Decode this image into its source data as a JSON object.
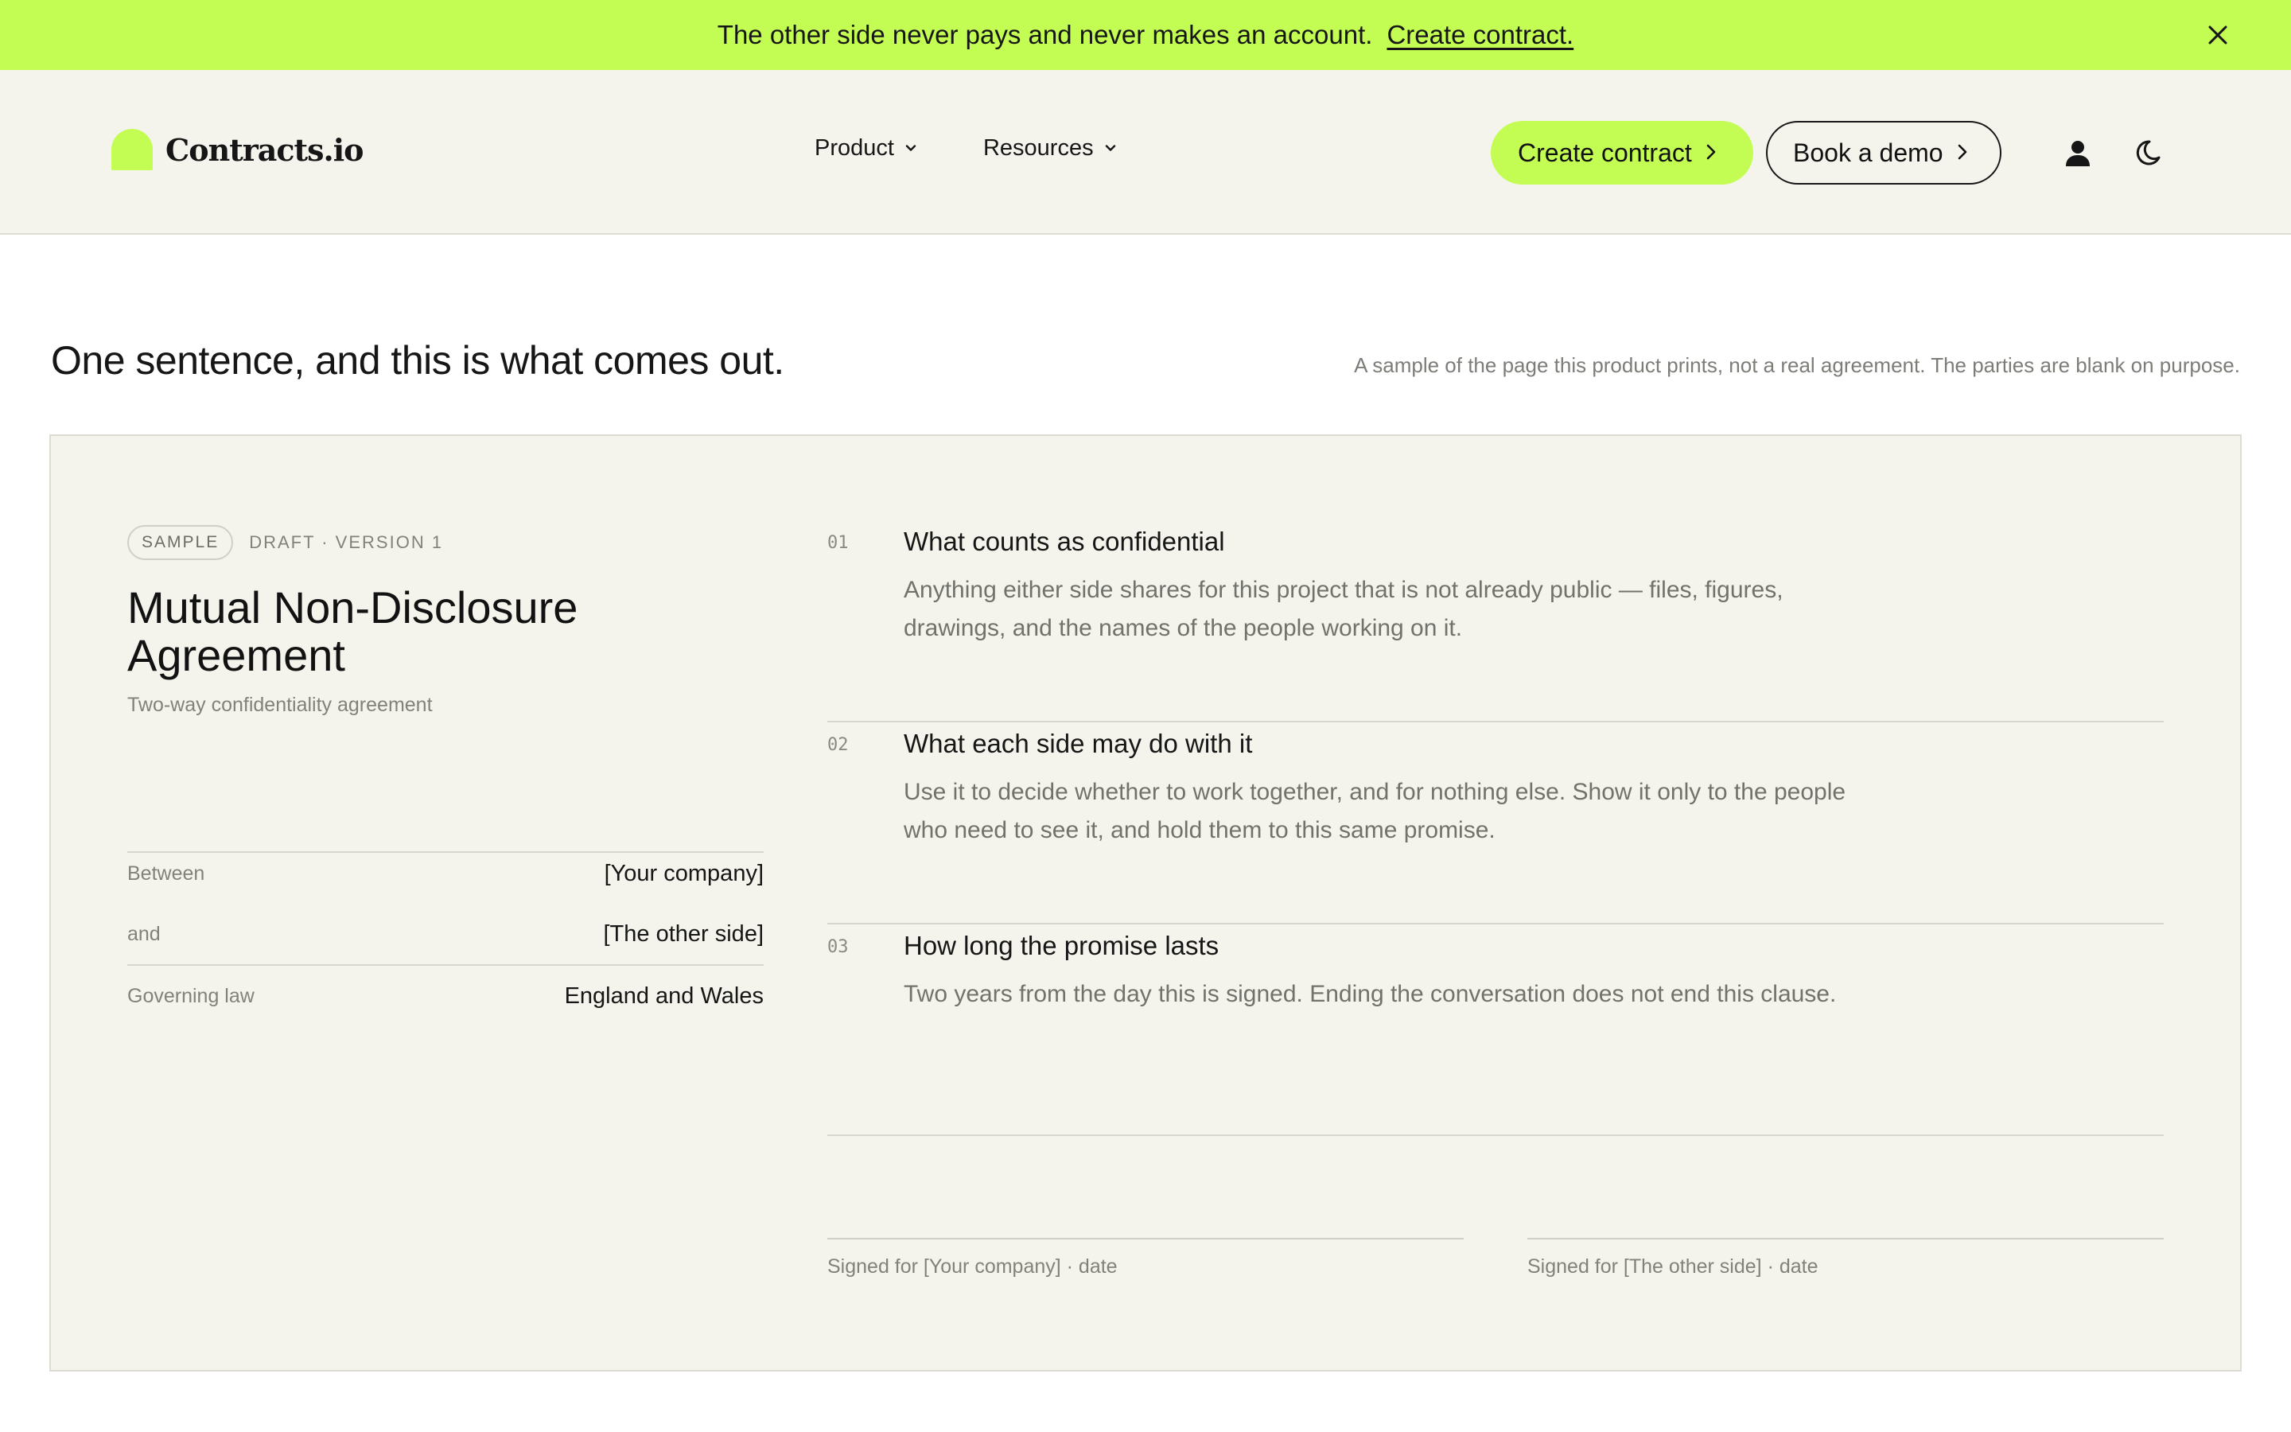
{
  "banner": {
    "message": "The other side never pays and never makes an account.",
    "cta": "Create contract."
  },
  "header": {
    "logo_text": "Contracts.io",
    "nav": [
      {
        "label": "Product"
      },
      {
        "label": "Resources"
      }
    ],
    "create_button": "Create contract",
    "demo_button": "Book a demo",
    "icons": [
      "user-icon",
      "moon-icon",
      "close-icon",
      "chevron-down-icon",
      "chevron-right-icon"
    ]
  },
  "intro": {
    "title": "One sentence, and this is what comes out.",
    "note": "A sample of the page this product prints, not a real agreement. The parties are blank on purpose."
  },
  "document": {
    "badge": "SAMPLE",
    "version": "DRAFT · VERSION 1",
    "title": "Mutual Non-Disclosure Agreement",
    "subtitle": "Two-way confidentiality agreement",
    "parties": [
      {
        "label": "Between",
        "value": "[Your company]"
      },
      {
        "label": "and",
        "value": "[The other side]"
      },
      {
        "label": "Governing law",
        "value": "England and Wales"
      }
    ],
    "clauses": [
      {
        "number": "01",
        "heading": "What counts as confidential",
        "body": "Anything either side shares for this project that is not already public — files, figures, drawings, and the names of the people working on it."
      },
      {
        "number": "02",
        "heading": "What each side may do with it",
        "body": "Use it to decide whether to work together, and for nothing else. Show it only to the people who need to see it, and hold them to this same promise."
      },
      {
        "number": "03",
        "heading": "How long the promise lasts",
        "body": "Two years from the day this is signed. Ending the conversation does not end this clause."
      }
    ],
    "signatures": [
      {
        "label": "Signed for [Your company] · date"
      },
      {
        "label": "Signed for [The other side] · date"
      }
    ]
  },
  "colors": {
    "accent": "#c3fd54",
    "card_background": "#f4f4ec",
    "text": "#161616",
    "muted_text": "#82827c"
  }
}
